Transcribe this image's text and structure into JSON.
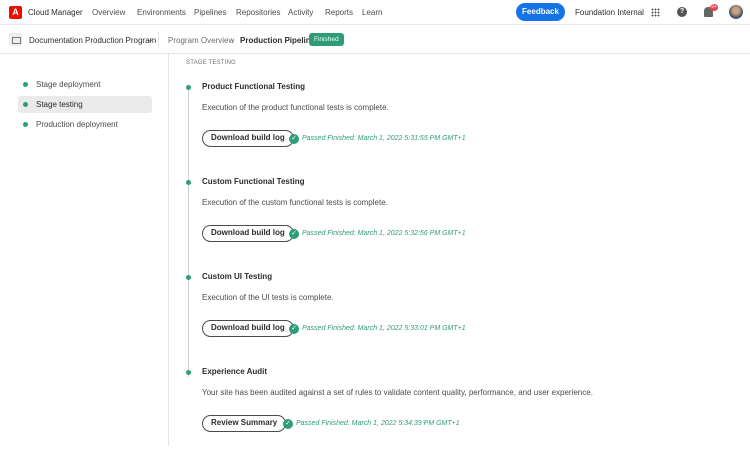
{
  "header": {
    "logo": "A",
    "app_name": "Cloud Manager",
    "nav": [
      "Overview",
      "Environments",
      "Pipelines",
      "Repositories",
      "Activity",
      "Reports",
      "Learn"
    ],
    "feedback": "Feedback",
    "org": "Foundation Internal",
    "help": "?",
    "notifications": "9+"
  },
  "subheader": {
    "program": "Documentation Production Program",
    "breadcrumb": [
      "Program Overview",
      "Production Pipeline"
    ],
    "status": "Finished"
  },
  "sidebar": {
    "items": [
      "Stage deployment",
      "Stage testing",
      "Production deployment"
    ]
  },
  "main": {
    "stage_label": "STAGE TESTING",
    "sections": [
      {
        "title": "Product Functional Testing",
        "desc": "Execution of the product functional tests is complete.",
        "button": "Download build log",
        "status": "Passed",
        "finished": "Finished: March 1, 2022 5:31:55 PM GMT+1"
      },
      {
        "title": "Custom Functional Testing",
        "desc": "Execution of the custom functional tests is complete.",
        "button": "Download build log",
        "status": "Passed",
        "finished": "Finished: March 1, 2022 5:32:56 PM GMT+1"
      },
      {
        "title": "Custom UI Testing",
        "desc": "Execution of the UI tests is complete.",
        "button": "Download build log",
        "status": "Passed",
        "finished": "Finished: March 1, 2022 5:33:01 PM GMT+1"
      },
      {
        "title": "Experience Audit",
        "desc": "Your site has been audited against a set of rules to validate content quality, performance, and user experience.",
        "button": "Review Summary",
        "status": "Passed",
        "finished": "Finished: March 1, 2022 5:34:39 PM GMT+1"
      }
    ]
  }
}
